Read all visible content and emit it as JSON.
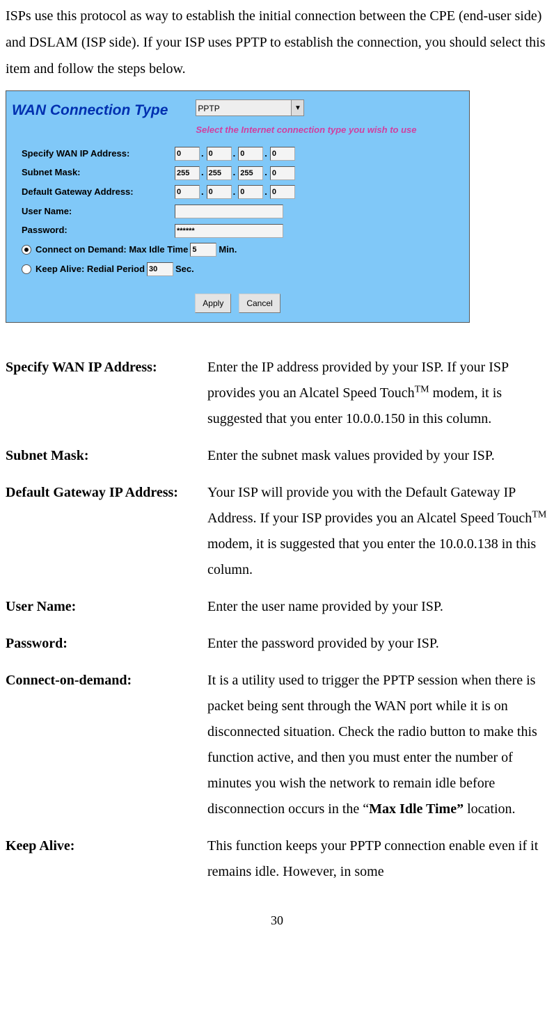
{
  "intro": "ISPs use this protocol as way to establish the initial connection between the CPE (end-user side) and DSLAM (ISP side). If your ISP uses PPTP to establish the connection, you should select this item and follow the steps below.",
  "screenshot": {
    "title": "WAN Connection Type",
    "dropdown_value": "PPTP",
    "subtitle": "Select the Internet connection type you wish to use",
    "rows": {
      "wan_ip_label": "Specify WAN IP Address:",
      "wan_ip": [
        "0",
        "0",
        "0",
        "0"
      ],
      "subnet_label": "Subnet Mask:",
      "subnet": [
        "255",
        "255",
        "255",
        "0"
      ],
      "gateway_label": "Default Gateway Address:",
      "gateway": [
        "0",
        "0",
        "0",
        "0"
      ],
      "user_label": "User Name:",
      "user_value": "",
      "pwd_label": "Password:",
      "pwd_value": "******",
      "connect_demand_prefix": "Connect on Demand: Max Idle Time",
      "connect_demand_value": "5",
      "connect_demand_suffix": "Min.",
      "keep_alive_prefix": "Keep Alive: Redial Period",
      "keep_alive_value": "30",
      "keep_alive_suffix": "Sec."
    },
    "buttons": {
      "apply": "Apply",
      "cancel": "Cancel"
    }
  },
  "defs": [
    {
      "term": "Specify WAN IP Address:",
      "desc_pre": "Enter the IP address provided by your ISP. If your ISP provides you an Alcatel Speed Touch",
      "tm": "TM",
      "desc_post": " modem, it is suggested that you enter 10.0.0.150 in this column."
    },
    {
      "term": "Subnet Mask:",
      "desc": "Enter the subnet mask values provided by your ISP."
    },
    {
      "term": "Default Gateway IP Address:",
      "desc_pre": "Your ISP will provide you with the Default Gateway IP Address. If your ISP provides you an Alcatel Speed Touch",
      "tm": "TM",
      "desc_post": " modem, it is suggested that you enter the 10.0.0.138 in this column."
    },
    {
      "term": "User Name:",
      "desc": "Enter the user name provided by your ISP."
    },
    {
      "term": "Password:",
      "desc": "Enter the password provided by your ISP."
    },
    {
      "term": "Connect-on-demand:",
      "desc_pre": "It is a utility used to trigger the PPTP session when there is packet being sent through the WAN port while it is on disconnected situation. Check the radio button to make this function active, and then you must enter the number of minutes you wish the network to remain idle before disconnection occurs in the “",
      "bold": "Max Idle Time”",
      "desc_post": " location."
    },
    {
      "term": "Keep Alive:",
      "desc": "This function keeps your PPTP connection enable even if it remains idle. However, in some"
    }
  ],
  "page_number": "30"
}
